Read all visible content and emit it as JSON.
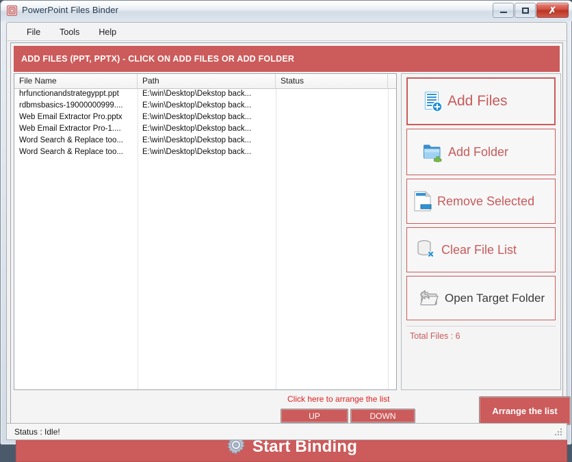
{
  "window": {
    "title": "PowerPoint Files Binder",
    "app_icon": "app-icon",
    "buttons": {
      "minimize": "minimize-icon",
      "maximize": "maximize-icon",
      "close": "✗"
    }
  },
  "menubar": {
    "items": [
      {
        "label": "File"
      },
      {
        "label": "Tools"
      },
      {
        "label": "Help"
      }
    ]
  },
  "banner": {
    "text": "ADD FILES (PPT, PPTX) - CLICK ON ADD FILES OR ADD FOLDER",
    "color": "#cc5b5b"
  },
  "filelist": {
    "columns": [
      "File Name",
      "Path",
      "Status",
      ""
    ],
    "rows": [
      {
        "name": "hrfunctionandstrategyppt.ppt",
        "path": "E:\\win\\Desktop\\Dekstop back...",
        "status": ""
      },
      {
        "name": "rdbmsbasics-19000000999....",
        "path": "E:\\win\\Desktop\\Dekstop back...",
        "status": ""
      },
      {
        "name": "Web Email Extractor Pro.pptx",
        "path": "E:\\win\\Desktop\\Dekstop back...",
        "status": ""
      },
      {
        "name": "Web Email Extractor Pro-1....",
        "path": "E:\\win\\Desktop\\Dekstop back...",
        "status": ""
      },
      {
        "name": "Word Search & Replace too...",
        "path": "E:\\win\\Desktop\\Dekstop back...",
        "status": ""
      },
      {
        "name": "Word Search & Replace too...",
        "path": "E:\\win\\Desktop\\Dekstop back...",
        "status": ""
      }
    ]
  },
  "sidebar": {
    "buttons": [
      {
        "label": "Add Files",
        "icon": "add-files-icon",
        "focused": true
      },
      {
        "label": "Add Folder",
        "icon": "add-folder-icon",
        "focused": false
      },
      {
        "label": "Remove Selected",
        "icon": "remove-selected-icon",
        "focused": false
      },
      {
        "label": "Clear File List",
        "icon": "clear-file-list-icon",
        "focused": false
      },
      {
        "label": "Open Target Folder",
        "icon": "open-target-folder-icon",
        "focused": false
      }
    ],
    "total_files_label": "Total Files : 6"
  },
  "arrange": {
    "hint": "Click here to arrange the list",
    "up_label": "UP",
    "down_label": "DOWN",
    "arrange_label": "Arrange the list"
  },
  "start": {
    "label": "Start Binding",
    "icon": "gear-icon"
  },
  "status": {
    "text": "Status  :  Idle!"
  },
  "colors": {
    "accent_red": "#cc5b5b",
    "label_red": "#c85a5a",
    "hint_red": "#e02020",
    "dark_label": "#3b3b3b"
  }
}
